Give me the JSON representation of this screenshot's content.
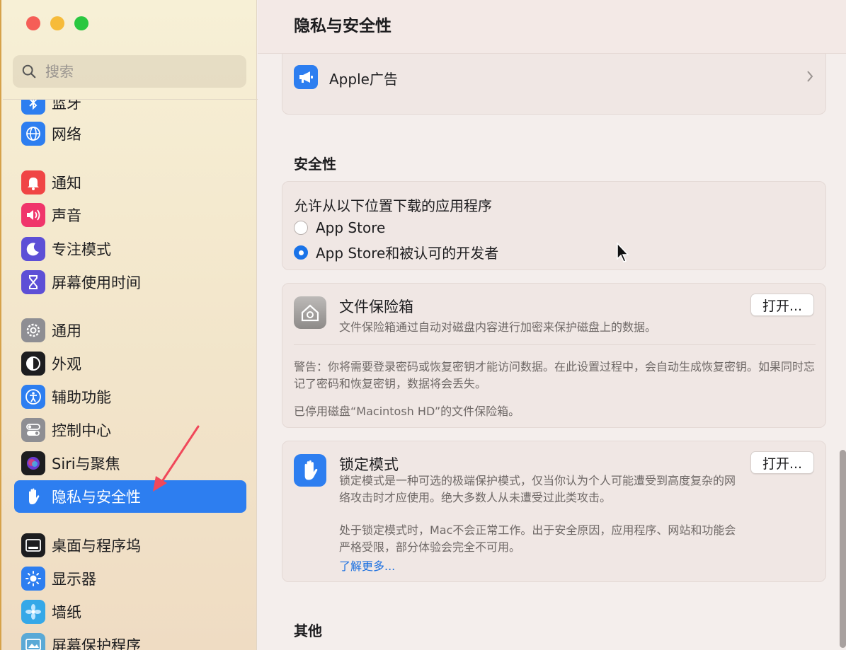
{
  "sidebar": {
    "search_placeholder": "搜索",
    "items": [
      {
        "label": "蓝牙",
        "icon": "bluetooth-icon",
        "color": "#2d7ef0"
      },
      {
        "label": "网络",
        "icon": "globe-icon",
        "color": "#2d7ef0"
      },
      {
        "label": "通知",
        "icon": "bell-icon",
        "color": "#f04545"
      },
      {
        "label": "声音",
        "icon": "speaker-icon",
        "color": "#f0356b"
      },
      {
        "label": "专注模式",
        "icon": "moon-icon",
        "color": "#5d4fd6"
      },
      {
        "label": "屏幕使用时间",
        "icon": "hourglass-icon",
        "color": "#5d4fd6"
      },
      {
        "label": "通用",
        "icon": "gear-icon",
        "color": "#8e8e93"
      },
      {
        "label": "外观",
        "icon": "appearance-icon",
        "color": "#1d1d1f"
      },
      {
        "label": "辅助功能",
        "icon": "accessibility-icon",
        "color": "#2d7ef0"
      },
      {
        "label": "控制中心",
        "icon": "toggles-icon",
        "color": "#8e8e93"
      },
      {
        "label": "Siri与聚焦",
        "icon": "siri-icon",
        "color": "#1d1d1f"
      },
      {
        "label": "隐私与安全性",
        "icon": "hand-icon",
        "color": "#2d7ef0"
      },
      {
        "label": "桌面与程序坞",
        "icon": "dock-icon",
        "color": "#1d1d1f"
      },
      {
        "label": "显示器",
        "icon": "sun-icon",
        "color": "#2d7ef0"
      },
      {
        "label": "墙纸",
        "icon": "flower-icon",
        "color": "#35a8e8"
      },
      {
        "label": "屏幕保护程序",
        "icon": "screensaver-icon",
        "color": "#5aa9d6"
      }
    ]
  },
  "header": {
    "title": "隐私与安全性"
  },
  "main": {
    "apple_ads": {
      "label": "Apple广告",
      "icon": "megaphone-icon"
    },
    "security": {
      "title": "安全性",
      "download_title": "允许从以下位置下载的应用程序",
      "options": [
        "App Store",
        "App Store和被认可的开发者"
      ],
      "selected_index": 1
    },
    "filevault": {
      "title": "文件保险箱",
      "desc": "文件保险箱通过自动对磁盘内容进行加密来保护磁盘上的数据。",
      "button": "打开...",
      "warning": "警告：你将需要登录密码或恢复密钥才能访问数据。在此设置过程中，会自动生成恢复密钥。如果同时忘记了密码和恢复密钥，数据将会丢失。",
      "status": "已停用磁盘“Macintosh HD”的文件保险箱。"
    },
    "lockdown": {
      "title": "锁定模式",
      "desc": "锁定模式是一种可选的极端保护模式，仅当你认为个人可能遭受到高度复杂的网络攻击时才应使用。绝大多数人从未遭受过此类攻击。",
      "desc2": "处于锁定模式时，Mac不会正常工作。出于安全原因，应用程序、网站和功能会严格受限，部分体验会完全不可用。",
      "link": "了解更多...",
      "button": "打开..."
    },
    "other_title": "其他"
  }
}
